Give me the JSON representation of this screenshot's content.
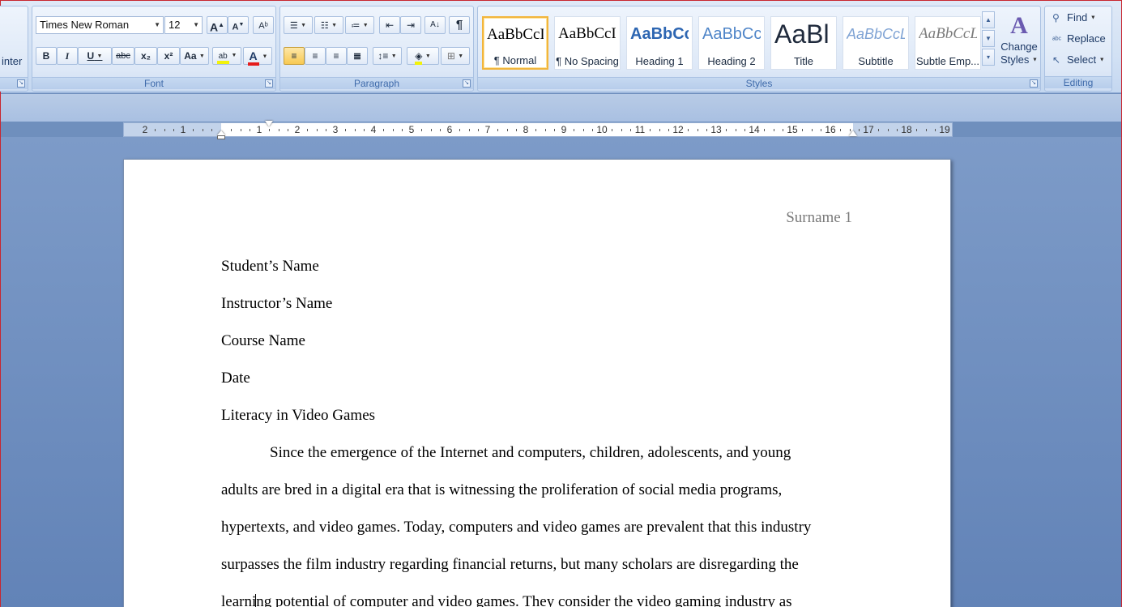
{
  "ribbon": {
    "clipboard_partial": "inter",
    "font": {
      "label": "Font",
      "font_name": "Times New Roman",
      "font_size": "12",
      "grow_label": "A",
      "shrink_label": "A",
      "bold": "B",
      "italic": "I",
      "underline": "U",
      "strike": "abc",
      "subscript": "x₂",
      "superscript": "x²",
      "change_case": "Aa",
      "highlight": "ab",
      "font_color": "A"
    },
    "paragraph": {
      "label": "Paragraph",
      "show_marks": "¶",
      "sort": "A↓"
    },
    "styles": {
      "label": "Styles",
      "tiles": [
        {
          "sample": "AaBbCcI",
          "name": "¶ Normal"
        },
        {
          "sample": "AaBbCcI",
          "name": "¶ No Spacing"
        },
        {
          "sample": "AaBbCc",
          "name": "Heading 1"
        },
        {
          "sample": "AaBbCc",
          "name": "Heading 2"
        },
        {
          "sample": "AaBl",
          "name": "Title"
        },
        {
          "sample": "AaBbCcL",
          "name": "Subtitle"
        },
        {
          "sample": "AaBbCcL",
          "name": "Subtle Emp..."
        }
      ],
      "change_styles_line1": "Change",
      "change_styles_line2": "Styles",
      "change_styles_icon": "A"
    },
    "editing": {
      "label": "Editing",
      "find": "Find",
      "replace": "Replace",
      "select": "Select"
    }
  },
  "ruler": {
    "left_numbers": [
      "2",
      "1"
    ],
    "right_numbers": [
      "1",
      "2",
      "3",
      "4",
      "5",
      "6",
      "7",
      "8",
      "9",
      "10",
      "11",
      "12",
      "13",
      "14",
      "15",
      "16",
      "17",
      "18",
      "19"
    ]
  },
  "document": {
    "header": "Surname 1",
    "lines": [
      "Student’s Name",
      "Instructor’s Name",
      "Course Name",
      "Date",
      "Literacy in Video Games",
      "Since the emergence of the Internet and computers, children, adolescents, and young",
      "adults are bred in a digital era that is witnessing the proliferation of social media programs,",
      "hypertexts, and video games. Today, computers and video games are prevalent that this industry",
      "surpasses the film industry regarding financial returns, but many scholars are disregarding the",
      "learning potential of computer and video games. They consider the video gaming industry as"
    ]
  },
  "colors": {
    "accent": "#3e6aaa",
    "selected_tile_border": "#f2b53c",
    "heading_blue": "#2d66b2",
    "workspace": "#6f8fbd"
  }
}
